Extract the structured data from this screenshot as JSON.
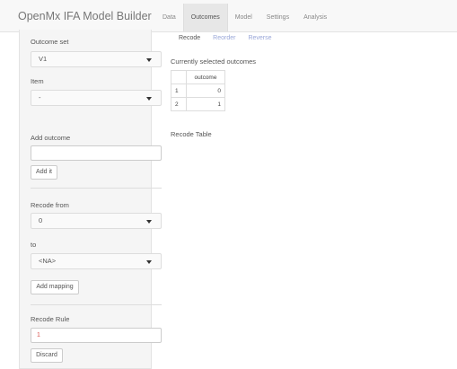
{
  "app": {
    "title": "OpenMx IFA Model Builder"
  },
  "nav": {
    "tabs": [
      "Data",
      "Outcomes",
      "Model",
      "Settings",
      "Analysis"
    ],
    "active": "Outcomes"
  },
  "subtabs": {
    "items": [
      "Recode",
      "Reorder",
      "Reverse"
    ],
    "active": "Recode"
  },
  "sidebar": {
    "outcome_set_label": "Outcome set",
    "outcome_set_value": "V1",
    "item_label": "Item",
    "item_value": "-",
    "add_outcome_label": "Add outcome",
    "add_outcome_value": "",
    "add_button": "Add it",
    "recode_from_label": "Recode from",
    "recode_from_value": "0",
    "to_label": "to",
    "to_value": "<NA>",
    "add_mapping_button": "Add mapping",
    "recode_rule_label": "Recode Rule",
    "recode_rule_value": "1",
    "discard_button": "Discard"
  },
  "main": {
    "selected_title": "Currently selected outcomes",
    "table": {
      "header": "outcome",
      "rows": [
        {
          "index": "1",
          "value": "0"
        },
        {
          "index": "2",
          "value": "1"
        }
      ]
    },
    "recode_table_title": "Recode Table"
  }
}
